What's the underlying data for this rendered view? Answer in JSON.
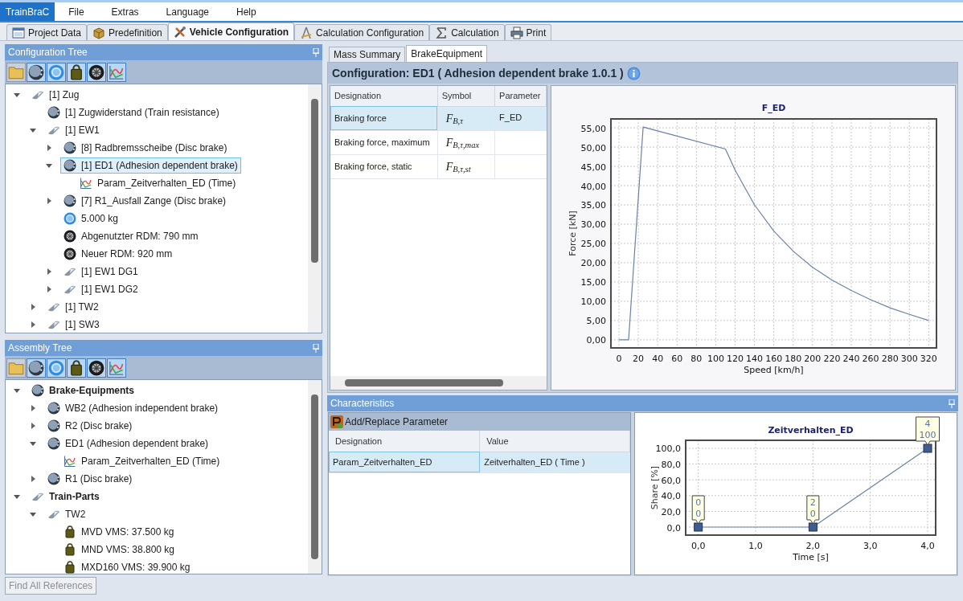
{
  "app_button": "TrainBraC",
  "menu": [
    "File",
    "Extras",
    "Language",
    "Help"
  ],
  "main_tabs": [
    {
      "label": "Project Data",
      "kind": "window",
      "selected": false
    },
    {
      "label": "Predefinition",
      "kind": "box",
      "selected": false
    },
    {
      "label": "Vehicle Configuration",
      "kind": "tools",
      "selected": true
    },
    {
      "label": "Calculation Configuration",
      "kind": "pen",
      "selected": false
    },
    {
      "label": "Calculation",
      "kind": "sigma",
      "selected": false
    },
    {
      "label": "Print",
      "kind": "printer",
      "selected": false
    }
  ],
  "config_tree": {
    "title": "Configuration Tree",
    "toolbar": [
      {
        "kind": "folder",
        "on": false
      },
      {
        "kind": "disc",
        "on": true
      },
      {
        "kind": "ring",
        "on": true
      },
      {
        "kind": "weight",
        "on": true
      },
      {
        "kind": "wheel",
        "on": true
      },
      {
        "kind": "curve",
        "on": true
      }
    ],
    "items": [
      {
        "label": "[1] Zug",
        "kind": "train",
        "expanded": true,
        "selected": false,
        "children": [
          {
            "label": "[1] Zugwiderstand (Train resistance)",
            "kind": "disc",
            "selected": false
          },
          {
            "label": "[1] EW1",
            "kind": "train",
            "expanded": true,
            "selected": false,
            "children": [
              {
                "label": "[8] Radbremsscheibe (Disc brake)",
                "kind": "disc",
                "expanded": false,
                "selected": false
              },
              {
                "label": "[1] ED1 (Adhesion dependent brake)",
                "kind": "disc",
                "expanded": true,
                "selected": true,
                "children": [
                  {
                    "label": "Param_Zeitverhalten_ED (Time)",
                    "kind": "curve",
                    "selected": false
                  }
                ]
              },
              {
                "label": "[7] R1_Ausfall Zange (Disc brake)",
                "kind": "disc",
                "expanded": false,
                "selected": false
              },
              {
                "label": "5.000 kg",
                "kind": "ring",
                "selected": false
              },
              {
                "label": "Abgenutzter RDM: 790 mm",
                "kind": "wheel",
                "selected": false
              },
              {
                "label": "Neuer RDM: 920 mm",
                "kind": "wheel",
                "selected": false
              },
              {
                "label": "[1] EW1 DG1",
                "kind": "train",
                "expanded": false,
                "selected": false
              },
              {
                "label": "[1] EW1 DG2",
                "kind": "train",
                "expanded": false,
                "selected": false
              }
            ]
          },
          {
            "label": "[1] TW2",
            "kind": "train",
            "expanded": false,
            "selected": false
          },
          {
            "label": "[1] SW3",
            "kind": "train",
            "expanded": false,
            "selected": false
          }
        ]
      }
    ]
  },
  "assembly_tree": {
    "title": "Assembly Tree",
    "toolbar": [
      {
        "kind": "folder",
        "on": false
      },
      {
        "kind": "disc",
        "on": true
      },
      {
        "kind": "ring",
        "on": true
      },
      {
        "kind": "weight",
        "on": true
      },
      {
        "kind": "wheel",
        "on": true
      },
      {
        "kind": "curve",
        "on": true
      }
    ],
    "items": [
      {
        "label": "Brake-Equipments",
        "kind": "disc",
        "expanded": true,
        "bold": true,
        "selected": false,
        "children": [
          {
            "label": "WB2 (Adhesion independent brake)",
            "kind": "disc",
            "expanded": false,
            "selected": false
          },
          {
            "label": "R2 (Disc brake)",
            "kind": "disc",
            "expanded": false,
            "selected": false
          },
          {
            "label": "ED1 (Adhesion dependent brake)",
            "kind": "disc",
            "expanded": true,
            "selected": false,
            "children": [
              {
                "label": "Param_Zeitverhalten_ED (Time)",
                "kind": "curve",
                "selected": false
              }
            ]
          },
          {
            "label": "R1 (Disc brake)",
            "kind": "disc",
            "expanded": false,
            "selected": false
          }
        ]
      },
      {
        "label": "Train-Parts",
        "kind": "train",
        "expanded": true,
        "bold": true,
        "selected": false,
        "children": [
          {
            "label": "TW2",
            "kind": "train",
            "expanded": true,
            "selected": false,
            "children": [
              {
                "label": "MVD VMS: 37.500 kg",
                "kind": "weight",
                "selected": false
              },
              {
                "label": "MND VMS: 38.800 kg",
                "kind": "weight",
                "selected": false
              },
              {
                "label": "MXD160 VMS: 39.900 kg",
                "kind": "weight",
                "selected": false
              }
            ]
          }
        ]
      }
    ]
  },
  "find_button": {
    "label": "Find All References",
    "disabled": true
  },
  "detail_tabs": [
    {
      "label": "Mass Summary",
      "selected": false
    },
    {
      "label": "BrakeEquipment",
      "selected": true
    }
  ],
  "configuration": {
    "title": "Configuration: ED1 ( Adhesion dependent brake 1.0.1 )"
  },
  "parameters_table": {
    "columns": [
      "Designation",
      "Symbol",
      "Parameter"
    ],
    "rows": [
      {
        "designation": "Braking force",
        "symbol": "F$_{B,τ}$",
        "parameter": "F_ED",
        "selected": true
      },
      {
        "designation": "Braking force, maximum",
        "symbol": "F$_{B,τ,max}$",
        "selected": false
      },
      {
        "designation": "Braking force, static",
        "symbol": "F$_{B,τ,st}$",
        "selected": false
      }
    ]
  },
  "force_chart": {
    "chart_data": {
      "type": "line",
      "title": "F_ED",
      "xlabel": "Speed [km/h]",
      "ylabel": "Force [kN]",
      "grid": true,
      "x": [
        0,
        10,
        25,
        110,
        120,
        140,
        160,
        180,
        200,
        220,
        240,
        260,
        280,
        300,
        320
      ],
      "series": [
        {
          "color": "#6a82a8",
          "values": [
            0,
            0,
            55.2,
            49.5,
            44,
            35,
            28.2,
            23,
            18.8,
            15.5,
            12.8,
            10.4,
            8.3,
            6.6,
            5
          ]
        }
      ],
      "xlim": [
        -8.3,
        328
      ],
      "ylim": [
        -2.1,
        57.3
      ],
      "xticks": [
        0,
        20,
        40,
        60,
        80,
        100,
        120,
        140,
        160,
        180,
        200,
        220,
        240,
        260,
        280,
        300,
        320
      ],
      "yticks": [
        {
          "value": 0,
          "label": "0,00"
        },
        {
          "value": 5,
          "label": "5,00"
        },
        {
          "value": 10,
          "label": "10,00"
        },
        {
          "value": 15,
          "label": "15,00"
        },
        {
          "value": 20,
          "label": "20,00"
        },
        {
          "value": 25,
          "label": "25,00"
        },
        {
          "value": 30,
          "label": "30,00"
        },
        {
          "value": 35,
          "label": "35,00"
        },
        {
          "value": 40,
          "label": "40,00"
        },
        {
          "value": 45,
          "label": "45,00"
        },
        {
          "value": 50,
          "label": "50,00"
        },
        {
          "value": 55,
          "label": "55,00"
        }
      ]
    }
  },
  "characteristics": {
    "title": "Characteristics",
    "add_button": "Add/Replace Parameter",
    "columns": [
      "Designation",
      "Value"
    ],
    "rows": [
      {
        "designation": "Param_Zeitverhalten_ED",
        "value": "Zeitverhalten_ED ( Time )",
        "selected": true
      }
    ],
    "chart_data": {
      "type": "line",
      "title": "Zeitverhalten_ED",
      "xlabel": "Time [s]",
      "ylabel": "Share [%]",
      "grid": true,
      "x": [
        0,
        2,
        4
      ],
      "series": [
        {
          "color": "#6a82a8",
          "marker": "square",
          "values": [
            0,
            0,
            100
          ]
        }
      ],
      "xlim": [
        -0.22,
        4.14
      ],
      "ylim": [
        -10.2,
        110.2
      ],
      "xticks": [
        {
          "value": 0,
          "label": "0,0"
        },
        {
          "value": 1,
          "label": "1,0"
        },
        {
          "value": 2,
          "label": "2,0"
        },
        {
          "value": 3,
          "label": "3,0"
        },
        {
          "value": 4,
          "label": "4,0"
        }
      ],
      "yticks": [
        {
          "value": 0,
          "label": "0,0"
        },
        {
          "value": 20,
          "label": "20,0"
        },
        {
          "value": 40,
          "label": "40,0"
        },
        {
          "value": 60,
          "label": "60,0"
        },
        {
          "value": 80,
          "label": "80,0"
        },
        {
          "value": 100,
          "label": "100,0"
        }
      ],
      "value_labels": [
        [
          "0",
          "0"
        ],
        [
          "2",
          "0"
        ],
        [
          "4",
          "100"
        ]
      ]
    }
  }
}
